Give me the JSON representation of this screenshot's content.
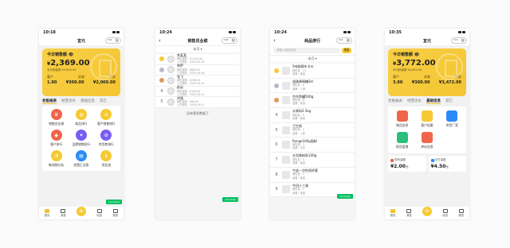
{
  "phone1": {
    "time": "10:18",
    "title": "宜元",
    "card": {
      "label": "今日销售额",
      "currency": "¥",
      "amount": "2,369.00",
      "sub_today": "本月销量额",
      "sub_today_value": "¥3,800.00",
      "metrics": [
        {
          "label": "客户",
          "value": "1.00"
        },
        {
          "label": "实收",
          "value": "¥300.00"
        },
        {
          "label": "欠款",
          "value": "¥2,069.00"
        }
      ]
    },
    "tabs": [
      "老板报表",
      "经营流水",
      "基础信息",
      "其它"
    ],
    "grid": [
      {
        "label": "销售员业绩",
        "color": "#f0654a",
        "glyph": "♛"
      },
      {
        "label": "商品排行",
        "color": "#f6c933",
        "glyph": "◍"
      },
      {
        "label": "客户销售排行",
        "color": "#f6c933",
        "glyph": "≡"
      },
      {
        "label": "客户排行",
        "color": "#f0654a",
        "glyph": "◆"
      },
      {
        "label": "品牌销售排行",
        "color": "#7a5cf5",
        "glyph": "✦"
      },
      {
        "label": "供货商排行",
        "color": "#7a5cf5",
        "glyph": "⚙"
      },
      {
        "label": "畅滞销分析",
        "color": "#f6c933",
        "glyph": "◔"
      },
      {
        "label": "经营汇总表",
        "color": "#2a8af6",
        "glyph": "▤"
      },
      {
        "label": "现金流",
        "color": "#f6c933",
        "glyph": "$"
      }
    ],
    "tabbar": [
      "首页",
      "消息",
      "",
      "动态",
      "我的"
    ]
  },
  "phone2": {
    "time": "10:24",
    "title": "销售员业绩",
    "filter": "本月 ▾",
    "rows": [
      {
        "rank": "1",
        "name": "李某某",
        "l1": "销售金额：¥1,234.00",
        "l2": "上次销售：2020-09-29"
      },
      {
        "rank": "2",
        "name": "李萨",
        "l1": "销售金额：¥800.00",
        "l2": "上次销售：2020-09-26"
      },
      {
        "rank": "3",
        "name": "张飞",
        "l1": "销售金额：¥236.00",
        "l2": "上次销售：2020-09-20"
      },
      {
        "rank": "4",
        "name": "赵云",
        "l1": "销售金额：¥100.00",
        "l2": "上次销售：2020-09-21"
      },
      {
        "rank": "5",
        "name": "刘强",
        "l1": "销售金额：¥80.00",
        "l2": "上次销售：2020-09-07"
      }
    ],
    "end": "没有更多数据了",
    "console": "vConsole"
  },
  "phone3": {
    "time": "10:24",
    "title": "商品排行",
    "search_placeholder": "请输入商品名称",
    "search_btn": "搜索",
    "filter": "本月 ▾",
    "rows": [
      {
        "rank": "1",
        "name": "5吨装载车卡口",
        "l1": "销售量：10",
        "l2": "品牌：某组"
      },
      {
        "rank": "2",
        "name": "成珠棒棒糖2kl",
        "l1": "销售量：8",
        "l2": "品牌：上海"
      },
      {
        "rank": "3",
        "name": "京东鱼罐500g",
        "l1": "销售量：6",
        "l2": "品牌：某组"
      },
      {
        "rank": "4",
        "name": "水果码2.5kg",
        "l1": "销售量：5",
        "l2": "品牌：某组"
      },
      {
        "rank": "5",
        "name": "卫生纸",
        "l1": "销售量：4",
        "l2": "品牌：上新"
      },
      {
        "rank": "6",
        "name": "Ronge100g面粉",
        "l1": "销售量：3",
        "l2": "品牌：中京"
      },
      {
        "rank": "7",
        "name": "五包装粉条100g",
        "l1": "销售量：3",
        "l2": "品牌：某组"
      },
      {
        "rank": "8",
        "name": "牛皮一次性纸杯套",
        "l1": "销售量：2",
        "l2": "品牌：某组"
      },
      {
        "rank": "9",
        "name": "中冠十三香",
        "l1": "销售量：1",
        "l2": "品牌：某组"
      }
    ],
    "console": "vConsole"
  },
  "phone4": {
    "time": "10:35",
    "title": "宜元",
    "card": {
      "label": "今日销售额",
      "currency": "¥",
      "amount": "3,772.00",
      "sub_today": "本月销量额",
      "sub_today_value": "¥4,800.00",
      "metrics": [
        {
          "label": "客户",
          "value": "3.00"
        },
        {
          "label": "实收",
          "value": "¥300.00"
        },
        {
          "label": "欠款",
          "value": "¥3,472.00"
        }
      ]
    },
    "tabs": [
      "老板报表",
      "经营流水",
      "基础信息",
      "其它"
    ],
    "grid": [
      {
        "label": "商品信息",
        "color": "#f0654a"
      },
      {
        "label": "客户档案",
        "color": "#f6c933"
      },
      {
        "label": "供货厂家",
        "color": "#2a8af6"
      },
      {
        "label": "职员管理",
        "color": "#2bbf7a"
      },
      {
        "label": "库存信息",
        "color": "#f0654a"
      }
    ],
    "bottom": [
      {
        "label": "现有金额",
        "value": "¥2.00",
        "unit": "元",
        "color": "#f0654a"
      },
      {
        "label": "应付金额",
        "value": "¥4.50",
        "unit": "元",
        "color": "#2a8af6"
      }
    ],
    "tabbar": [
      "首页",
      "消息",
      "",
      "动态",
      "我的"
    ]
  }
}
